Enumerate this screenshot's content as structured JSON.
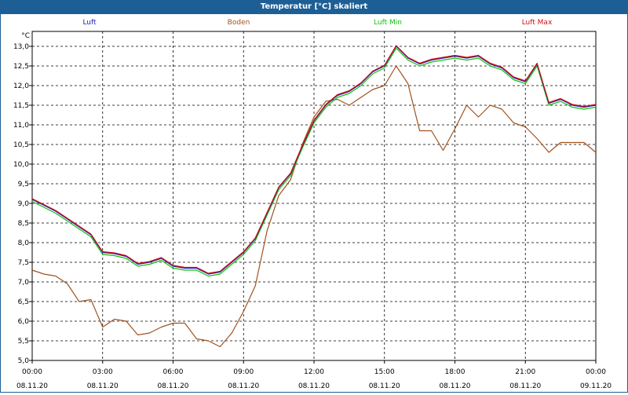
{
  "window": {
    "title": "Temperatur [°C] skaliert"
  },
  "chart_data": {
    "type": "line",
    "title": "Temperatur [°C] skaliert",
    "ylabel": "°C",
    "xlabel": "",
    "ylim": [
      5.0,
      13.3
    ],
    "xlim": [
      0,
      24
    ],
    "grid": true,
    "legend_placement": "top",
    "y_ticks": [
      "5,0",
      "5,5",
      "6,0",
      "6,5",
      "7,0",
      "7,5",
      "8,0",
      "8,5",
      "9,0",
      "9,5",
      "10,0",
      "10,5",
      "11,0",
      "11,5",
      "12,0",
      "12,5",
      "13,0"
    ],
    "x_ticks": [
      {
        "time": "00:00",
        "date": "08.11.20"
      },
      {
        "time": "03:00",
        "date": "08.11.20"
      },
      {
        "time": "06:00",
        "date": "08.11.20"
      },
      {
        "time": "09:00",
        "date": "08.11.20"
      },
      {
        "time": "12:00",
        "date": "08.11.20"
      },
      {
        "time": "15:00",
        "date": "08.11.20"
      },
      {
        "time": "18:00",
        "date": "08.11.20"
      },
      {
        "time": "21:00",
        "date": "08.11.20"
      },
      {
        "time": "00:00",
        "date": "09.11.20"
      }
    ],
    "x": [
      0,
      0.5,
      1,
      1.5,
      2,
      2.5,
      3,
      3.5,
      4,
      4.5,
      5,
      5.5,
      6,
      6.5,
      7,
      7.5,
      8,
      8.5,
      9,
      9.5,
      10,
      10.5,
      11,
      11.5,
      12,
      12.5,
      13,
      13.5,
      14,
      14.5,
      15,
      15.5,
      16,
      16.5,
      17,
      17.5,
      18,
      18.5,
      19,
      19.5,
      20,
      20.5,
      21,
      21.5,
      22,
      22.5,
      23,
      23.5,
      24
    ],
    "series": [
      {
        "name": "Luft",
        "color": "#1f1fb4",
        "values": [
          9.1,
          8.95,
          8.8,
          8.6,
          8.4,
          8.2,
          7.75,
          7.72,
          7.65,
          7.45,
          7.5,
          7.6,
          7.4,
          7.35,
          7.35,
          7.2,
          7.25,
          7.5,
          7.75,
          8.1,
          8.75,
          9.4,
          9.75,
          10.45,
          11.1,
          11.5,
          11.75,
          11.85,
          12.05,
          12.35,
          12.5,
          13.0,
          12.7,
          12.55,
          12.65,
          12.7,
          12.75,
          12.7,
          12.75,
          12.55,
          12.45,
          12.2,
          12.1,
          12.55,
          11.55,
          11.65,
          11.5,
          11.45,
          11.5
        ]
      },
      {
        "name": "Boden",
        "color": "#a0521e",
        "values": [
          7.3,
          7.2,
          7.15,
          6.95,
          6.5,
          6.55,
          5.85,
          6.05,
          6.0,
          5.65,
          5.7,
          5.85,
          5.95,
          5.95,
          5.55,
          5.5,
          5.35,
          5.7,
          6.25,
          6.9,
          8.3,
          9.2,
          9.6,
          10.5,
          11.2,
          11.6,
          11.65,
          11.5,
          11.7,
          11.9,
          12.0,
          12.5,
          12.05,
          10.85,
          10.85,
          10.35,
          10.9,
          11.5,
          11.2,
          11.5,
          11.4,
          11.05,
          10.95,
          10.65,
          10.3,
          10.55,
          10.55,
          10.55,
          10.3
        ]
      },
      {
        "name": "Luft Min",
        "color": "#10c010",
        "values": [
          9.05,
          8.9,
          8.75,
          8.55,
          8.35,
          8.15,
          7.7,
          7.67,
          7.6,
          7.4,
          7.45,
          7.55,
          7.35,
          7.3,
          7.3,
          7.15,
          7.2,
          7.45,
          7.7,
          8.05,
          8.7,
          9.35,
          9.7,
          10.4,
          11.05,
          11.45,
          11.7,
          11.8,
          12.0,
          12.3,
          12.45,
          12.95,
          12.65,
          12.5,
          12.6,
          12.65,
          12.7,
          12.65,
          12.7,
          12.5,
          12.4,
          12.15,
          12.05,
          12.5,
          11.5,
          11.6,
          11.45,
          11.4,
          11.45
        ]
      },
      {
        "name": "Luft Max",
        "color": "#d01010",
        "values": [
          9.12,
          8.97,
          8.82,
          8.62,
          8.42,
          8.22,
          7.77,
          7.74,
          7.67,
          7.47,
          7.52,
          7.62,
          7.42,
          7.37,
          7.37,
          7.22,
          7.27,
          7.52,
          7.77,
          8.12,
          8.77,
          9.42,
          9.77,
          10.47,
          11.12,
          11.52,
          11.77,
          11.87,
          12.07,
          12.37,
          12.52,
          13.02,
          12.72,
          12.57,
          12.67,
          12.72,
          12.77,
          12.72,
          12.77,
          12.57,
          12.47,
          12.22,
          12.12,
          12.57,
          11.57,
          11.67,
          11.52,
          11.47,
          11.52
        ]
      }
    ]
  }
}
